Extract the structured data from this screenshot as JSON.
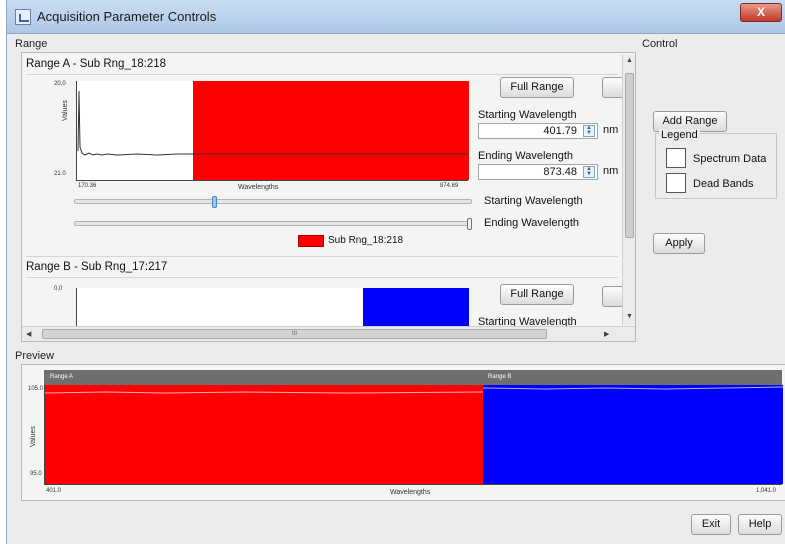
{
  "window": {
    "title": "Acquisition Parameter Controls",
    "close_label": "X"
  },
  "sections": {
    "range": "Range",
    "control": "Control",
    "preview": "Preview"
  },
  "range_a": {
    "title": "Range A - Sub Rng_18:218",
    "y_max": "20.0",
    "y_min": "21.0",
    "x_min": "170.36",
    "x_max": "874.69",
    "ylabel": "Values",
    "xlabel": "Wavelengths",
    "full_range_label": "Full Range",
    "starting_label": "Starting Wavelength",
    "starting_value": "401.79",
    "ending_label": "Ending Wavelength",
    "ending_value": "873.48",
    "unit": "nm",
    "slider_start_label": "Starting Wavelength",
    "slider_end_label": "Ending Wavelength",
    "slider_start_fraction": 0.35,
    "slider_end_fraction": 1.0,
    "legend_label": "Sub Rng_18:218",
    "band_color": "#ff0000"
  },
  "range_b": {
    "title": "Range B - Sub Rng_17:217",
    "y_max": "0.0",
    "full_range_label": "Full Range",
    "starting_label": "Starting Wavelength",
    "band_color": "#0000ff"
  },
  "control": {
    "add_range_label": "Add Range",
    "legend_title": "Legend",
    "spectrum_label": "Spectrum Data",
    "dead_bands_label": "Dead Bands",
    "apply_label": "Apply"
  },
  "preview": {
    "band_a_label": "Range A",
    "band_b_label": "Range B",
    "y_max": "105.0",
    "y_min": "95.0",
    "x_min": "401.0",
    "x_max": "1,041.0",
    "ylabel": "Values",
    "xlabel": "Wavelengths",
    "band_a_color": "#ff0000",
    "band_b_color": "#0000ff"
  },
  "footer": {
    "exit_label": "Exit",
    "help_label": "Help"
  },
  "scroll": {
    "hscroll_grip": "III"
  }
}
